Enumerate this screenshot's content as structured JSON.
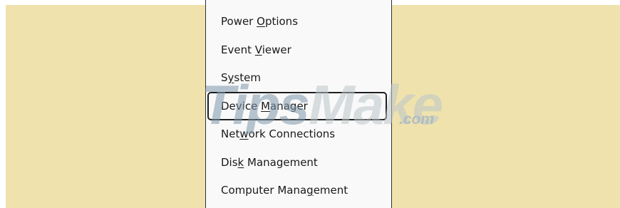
{
  "context_menu": {
    "items": [
      {
        "id": "power-options",
        "before": "Power ",
        "key": "O",
        "after": "ptions"
      },
      {
        "id": "event-viewer",
        "before": "Event ",
        "key": "V",
        "after": "iewer"
      },
      {
        "id": "system",
        "before": "S",
        "key": "y",
        "after": "stem"
      },
      {
        "id": "device-manager",
        "before": "Device ",
        "key": "M",
        "after": "anager",
        "focused": true
      },
      {
        "id": "network-connections",
        "before": "Net",
        "key": "w",
        "after": "ork Connections"
      },
      {
        "id": "disk-management",
        "before": "Dis",
        "key": "k",
        "after": " Management"
      },
      {
        "id": "computer-management",
        "before": "Computer Mana",
        "key": "g",
        "after": "ement"
      }
    ]
  },
  "watermark": {
    "brand": "TipsMake",
    "suffix": ".com",
    "colors": {
      "tips": "#7f98ab",
      "make": "#bcc5cb",
      "suffix": "#a7b7c3"
    }
  },
  "colors": {
    "desktop_background": "#efe2ad",
    "menu_background": "#f9f9f9",
    "menu_border": "#2f2f2f",
    "focus_border": "#1f1f1f",
    "text": "#1a1a1a"
  }
}
